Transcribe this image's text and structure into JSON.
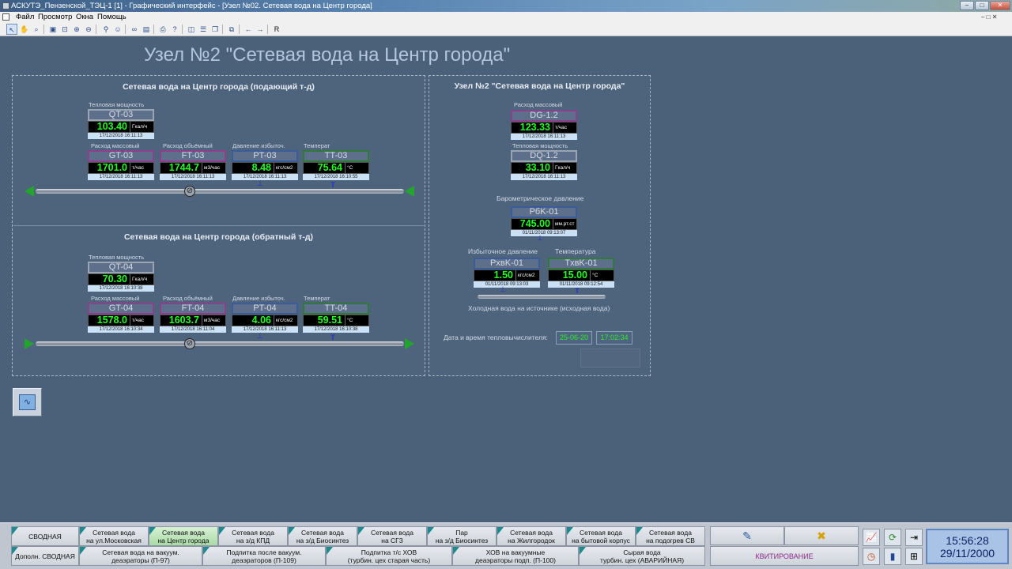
{
  "window": {
    "title": "АСКУТЭ_Пензенской_ТЭЦ-1 [1] - Графический интерфейс - [Узел №02. Сетевая вода на Центр города]"
  },
  "menu": {
    "items": [
      "Файл",
      "Просмотр",
      "Окна",
      "Помощь"
    ]
  },
  "toolbar": {
    "icons": [
      "select-arrow-icon",
      "hand-icon",
      "zoom-icon",
      "zoom-1-1-icon",
      "zoom-fit-icon",
      "zoom-in-icon",
      "zoom-out-icon",
      "find-icon",
      "user-icon",
      "binoculars-icon",
      "image-icon",
      "print-icon",
      "help-icon",
      "layout-icon",
      "list-icon",
      "window-icon",
      "tile-icon",
      "back-icon",
      "forward-icon",
      "refresh-icon"
    ],
    "r_label": "R"
  },
  "page": {
    "title": "Узел №2 \"Сетевая вода на Центр города\""
  },
  "supply": {
    "header": "Сетевая вода на Центр города (подающий т-д)",
    "qt": {
      "label": "Тепловая   мощность",
      "tag": "QT-03",
      "value": "103.40",
      "unit": "Гкал/ч",
      "ts": "17/12/2018 16:11:13"
    },
    "gt": {
      "label": "Расход    массовый",
      "tag": "GT-03",
      "value": "1701.0",
      "unit": "т/час",
      "ts": "17/12/2018 16:11:13"
    },
    "ft": {
      "label": "Расход    объёмный",
      "tag": "FT-03",
      "value": "1744.7",
      "unit": "м3/час",
      "ts": "17/12/2018 16:11:13"
    },
    "pt": {
      "label": "Давление   избыточ.",
      "tag": "PT-03",
      "value": "8.48",
      "unit": "кгс/см2",
      "ts": "17/12/2018 16:11:13"
    },
    "tt": {
      "label": "Температ",
      "tag": "TT-03",
      "value": "75.64",
      "unit": "°C",
      "ts": "17/12/2018 16:10:55"
    }
  },
  "return": {
    "header": "Сетевая вода на Центр города (обратный т-д)",
    "qt": {
      "label": "Тепловая   мощность",
      "tag": "QT-04",
      "value": "70.30",
      "unit": "Гкал/ч",
      "ts": "17/12/2018 16:10:38"
    },
    "gt": {
      "label": "Расход    массовый",
      "tag": "GT-04",
      "value": "1578.0",
      "unit": "т/час",
      "ts": "17/12/2018 16:10:34"
    },
    "ft": {
      "label": "Расход    объёмный",
      "tag": "FT-04",
      "value": "1603.7",
      "unit": "м3/час",
      "ts": "17/12/2018 16:11:04"
    },
    "pt": {
      "label": "Давление   избыточ.",
      "tag": "PT-04",
      "value": "4.06",
      "unit": "кгс/см2",
      "ts": "17/12/2018 16:11:13"
    },
    "tt": {
      "label": "Темперaт",
      "tag": "TT-04",
      "value": "59.51",
      "unit": "°C",
      "ts": "17/12/2018 16:10:38"
    }
  },
  "node": {
    "header": "Узел №2 \"Сетевая вода на Центр города\"",
    "dg": {
      "label": "Расход    массовый",
      "tag": "DG-1.2",
      "value": "123.33",
      "unit": "т/час",
      "ts": "17/12/2018 16:11:13"
    },
    "dq": {
      "label": "Тепловая  мощность",
      "tag": "DQ-1.2",
      "value": "33.10",
      "unit": "Гкал/ч",
      "ts": "17/12/2018 16:11:13"
    },
    "baro_title": "Барометрическое давление",
    "pbk": {
      "tag": "PбK-01",
      "value": "745.00",
      "unit": "мм.рт.ст",
      "ts": "01/11/2018 09:13:07"
    },
    "press_title": "Избыточное давление",
    "temp_title": "Температура",
    "pxb": {
      "tag": "PхвK-01",
      "value": "1.50",
      "unit": "кгс/см2",
      "ts": "01/11/2018 09:13:03"
    },
    "txb": {
      "tag": "TхвK-01",
      "value": "15.00",
      "unit": "°C",
      "ts": "01/11/2018 09:12:54"
    },
    "cold_water": "Холодная вода на источнике (исходная вода)",
    "dt_label": "Дата и время тепловычислителя:",
    "dt_date": "25-06-20",
    "dt_time": "17:02:34"
  },
  "nav": {
    "row1": [
      {
        "l1": "СВОДНАЯ",
        "l2": ""
      },
      {
        "l1": "Сетевая вода",
        "l2": "на ул.Московская"
      },
      {
        "l1": "Сетевая вода",
        "l2": "на Центр города"
      },
      {
        "l1": "Сетевая вода",
        "l2": "на з/д КПД"
      },
      {
        "l1": "Сетевая вода",
        "l2": "на з/д Биосинтез"
      },
      {
        "l1": "Сетевая вода",
        "l2": "на СГЗ"
      },
      {
        "l1": "Пар",
        "l2": "на з/д Биосинтез"
      },
      {
        "l1": "Сетевая вода",
        "l2": "на Жилгородок"
      },
      {
        "l1": "Сетевая вода",
        "l2": "на бытовой корпус"
      },
      {
        "l1": "Сетевая вода",
        "l2": "на подогрев СВ"
      }
    ],
    "row2": [
      {
        "l1": "Дополн. СВОДНАЯ",
        "l2": ""
      },
      {
        "l1": "Сетевая вода на вакуум.",
        "l2": "деаэраторы (П-97)"
      },
      {
        "l1": "Подпитка после вакуум.",
        "l2": "деаэраторов (П-109)"
      },
      {
        "l1": "Подпитка т/с ХОВ",
        "l2": "(турбин. цех старая часть)"
      },
      {
        "l1": "ХОВ на вакуумные",
        "l2": "деаэраторы подп. (П-100)"
      },
      {
        "l1": "Сырая вода",
        "l2": "турбин. цех (АВАРИЙНАЯ)"
      }
    ],
    "ack": "КВИТИРОВАНИЕ"
  },
  "clock": {
    "time": "15:56:28",
    "date": "29/11/2000"
  }
}
